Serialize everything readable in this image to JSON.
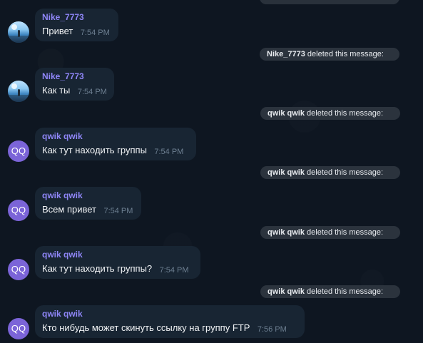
{
  "messages": [
    {
      "sender": "Nike_7773",
      "text": "Привет",
      "time": "7:54 PM",
      "avatar_type": "photo"
    },
    {
      "sender": "Nike_7773",
      "text": "Как ты",
      "time": "7:54 PM",
      "avatar_type": "photo"
    },
    {
      "sender": "qwik qwik",
      "text": "Как тут находить группы",
      "time": "7:54 PM",
      "avatar_type": "initials",
      "avatar_initials": "QQ"
    },
    {
      "sender": "qwik qwik",
      "text": "Всем привет",
      "time": "7:54 PM",
      "avatar_type": "initials",
      "avatar_initials": "QQ"
    },
    {
      "sender": "qwik qwik",
      "text": "Как тут находить группы?",
      "time": "7:54 PM",
      "avatar_type": "initials",
      "avatar_initials": "QQ"
    },
    {
      "sender": "qwik qwik",
      "text": "Кто нибудь может скинуть ссылку на группу FTP",
      "time": "7:56 PM",
      "avatar_type": "initials",
      "avatar_initials": "QQ"
    }
  ],
  "service_messages": [
    {
      "name": "Nike_7773",
      "text": "deleted this message:"
    },
    {
      "name": "qwik qwik",
      "text": "deleted this message:"
    },
    {
      "name": "qwik qwik",
      "text": "deleted this message:"
    },
    {
      "name": "qwik qwik",
      "text": "deleted this message:"
    },
    {
      "name": "qwik qwik",
      "text": "deleted this message:"
    }
  ],
  "colors": {
    "background": "#0e1621",
    "bubble": "#182533",
    "sender": "#8f86f7",
    "avatar_initials_bg": "#7b64d8",
    "service_bg": "#2b333d"
  },
  "icons": {
    "photo_avatar": "landscape-avatar-icon",
    "initials_avatar": "initials-avatar-icon"
  }
}
